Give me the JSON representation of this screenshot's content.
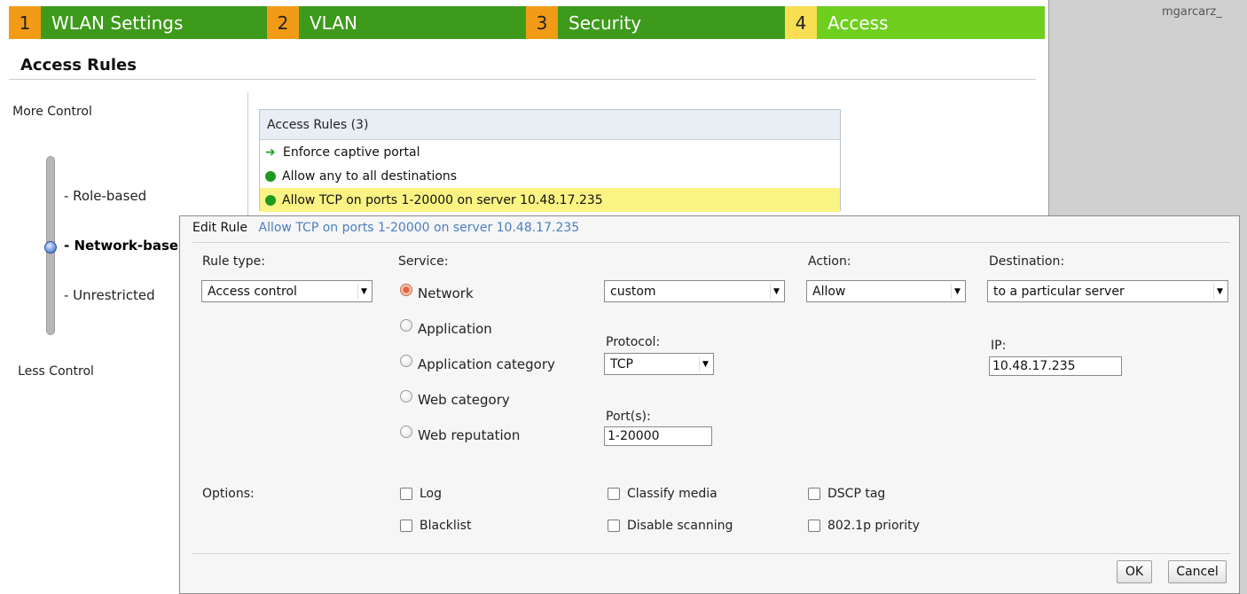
{
  "user": "mgarcarz_",
  "tabs": [
    {
      "num": "1",
      "label": "WLAN Settings"
    },
    {
      "num": "2",
      "label": "VLAN"
    },
    {
      "num": "3",
      "label": "Security"
    },
    {
      "num": "4",
      "label": "Access"
    }
  ],
  "page_title": "Access Rules",
  "control": {
    "more": "More Control",
    "less": "Less Control",
    "levels": [
      "- Role-based",
      "- Network-base",
      "- Unrestricted"
    ],
    "selected": "- Network-base"
  },
  "rules": {
    "header": "Access Rules (3)",
    "items": [
      {
        "icon": "arrow-icon",
        "text": "Enforce captive portal"
      },
      {
        "icon": "green-dot-icon",
        "text": "Allow any to all destinations"
      },
      {
        "icon": "green-dot-icon",
        "text": "Allow TCP on ports 1-20000 on server 10.48.17.235",
        "selected": true
      }
    ]
  },
  "edit_rule": {
    "label": "Edit Rule",
    "rule_name": "Allow TCP on ports 1-20000 on server 10.48.17.235",
    "rule_type_label": "Rule type:",
    "rule_type_value": "Access control",
    "service_label": "Service:",
    "service_options": [
      "Network",
      "Application",
      "Application category",
      "Web category",
      "Web reputation"
    ],
    "service_selected": "Network",
    "service_value": "custom",
    "protocol_label": "Protocol:",
    "protocol_value": "TCP",
    "ports_label": "Port(s):",
    "ports_value": "1-20000",
    "action_label": "Action:",
    "action_value": "Allow",
    "destination_label": "Destination:",
    "destination_value": "to a particular server",
    "ip_label": "IP:",
    "ip_value": "10.48.17.235",
    "options_label": "Options:",
    "options": [
      "Log",
      "Blacklist",
      "Classify media",
      "Disable scanning",
      "DSCP tag",
      "802.1p priority"
    ],
    "ok": "OK",
    "cancel": "Cancel"
  },
  "colors": {
    "tab_green": "#3d9a1b",
    "tab_active": "#6fcf1f",
    "tab_num": "#f29b16",
    "tab_num_active": "#f8de52",
    "selected_row": "#fbf383",
    "link_blue": "#4a7fc1"
  }
}
